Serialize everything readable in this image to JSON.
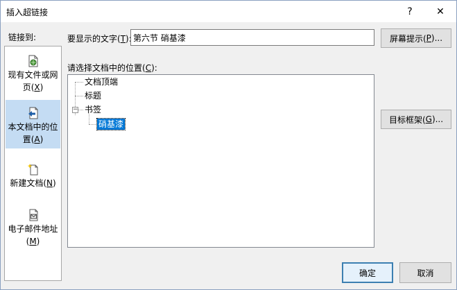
{
  "window": {
    "title": "插入超链接",
    "help_glyph": "?",
    "close_glyph": "✕"
  },
  "sidebar": {
    "label": "链接到:",
    "items": [
      {
        "line1": "现有文件或网",
        "line2_pre": "页(",
        "line2_key": "X",
        "line2_post": ")",
        "icon": "web-file-icon"
      },
      {
        "line1": "本文档中的位",
        "line2_pre": "置(",
        "line2_key": "A",
        "line2_post": ")",
        "icon": "place-in-document-icon",
        "selected": true
      },
      {
        "line1": "新建文档(",
        "line1_key": "N",
        "line1_post": ")",
        "icon": "new-document-icon"
      },
      {
        "line1": "电子邮件地址",
        "line2_pre": "(",
        "line2_key": "M",
        "line2_post": ")",
        "icon": "email-address-icon"
      }
    ]
  },
  "display_text": {
    "label_pre": "要显示的文字(",
    "label_key": "T",
    "label_post": "):",
    "value": "第六节  硝基漆"
  },
  "screentip_button": {
    "pre": "屏幕提示(",
    "key": "P",
    "post": ")..."
  },
  "location": {
    "label_pre": "请选择文档中的位置(",
    "label_key": "C",
    "label_post": "):",
    "tree": [
      {
        "label": "文档顶端"
      },
      {
        "label": "标题"
      },
      {
        "label": "书签",
        "expander": "−"
      },
      {
        "label": "硝基漆",
        "selected": true
      }
    ]
  },
  "target_frame_button": {
    "pre": "目标框架(",
    "key": "G",
    "post": ")..."
  },
  "ok_button": "确定",
  "cancel_button": "取消",
  "colors": {
    "accent": "#0078d7",
    "selection_bg": "#c4dcf3"
  }
}
